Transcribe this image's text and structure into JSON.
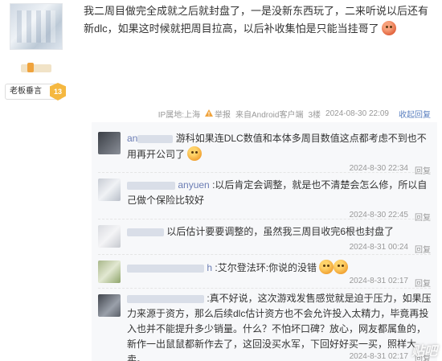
{
  "author": {
    "rank_title": "老板垂言",
    "rank_level": "13"
  },
  "post": {
    "text": "我二周目做完全成就之后就封盘了，一是没新东西玩了，二来听说以后还有新dlc，如果这时候就把周目拉高，以后补收集怕是只能当挂哥了",
    "ip_location": "IP属地:上海",
    "report_label": "举报",
    "client": "来自Android客户端",
    "floor": "3楼",
    "timestamp": "2024-08-30 22:09",
    "reply_label": "收起回复"
  },
  "replies": [
    {
      "user_prefix": "an",
      "text": "游科如果连DLC数值和本体多周目数值这点都考虑不到也不用再开公司了",
      "time": "2024-8-30 22:34",
      "reply_label": "回复"
    },
    {
      "user_prefix": "",
      "user_suffix": "anyuen",
      "text": ":以后肯定会调整，就是也不清楚会怎么修，所以自己做个保险比较好",
      "time": "2024-8-30 22:45",
      "reply_label": "回复"
    },
    {
      "user_prefix": "",
      "text": "以后估计要要调整的，虽然我三周目收完6根也封盘了",
      "time": "2024-8-31 00:24",
      "reply_label": "回复"
    },
    {
      "user_prefix": "",
      "user_suffix": "h",
      "text": ":艾尔登法环:你说的没错",
      "time": "2024-8-31 02:17",
      "reply_label": "回复"
    },
    {
      "user_prefix": "",
      "text": ":真不好说，这次游戏发售感觉就是迫于压力，如果压力来源于资方，那么后续dlc估计资方也不会允许投入太精力，毕竟再投入也并不能提升多少销量。什么？不怕坏口碑？放心，网友都属鱼的，新作一出鼠鼠都新作去了，这回没买水军，下回好好买一买，照样大卖。",
      "time": "2024-8-31 02:17",
      "reply_label": "回复"
    }
  ],
  "watermark": "贴吧"
}
